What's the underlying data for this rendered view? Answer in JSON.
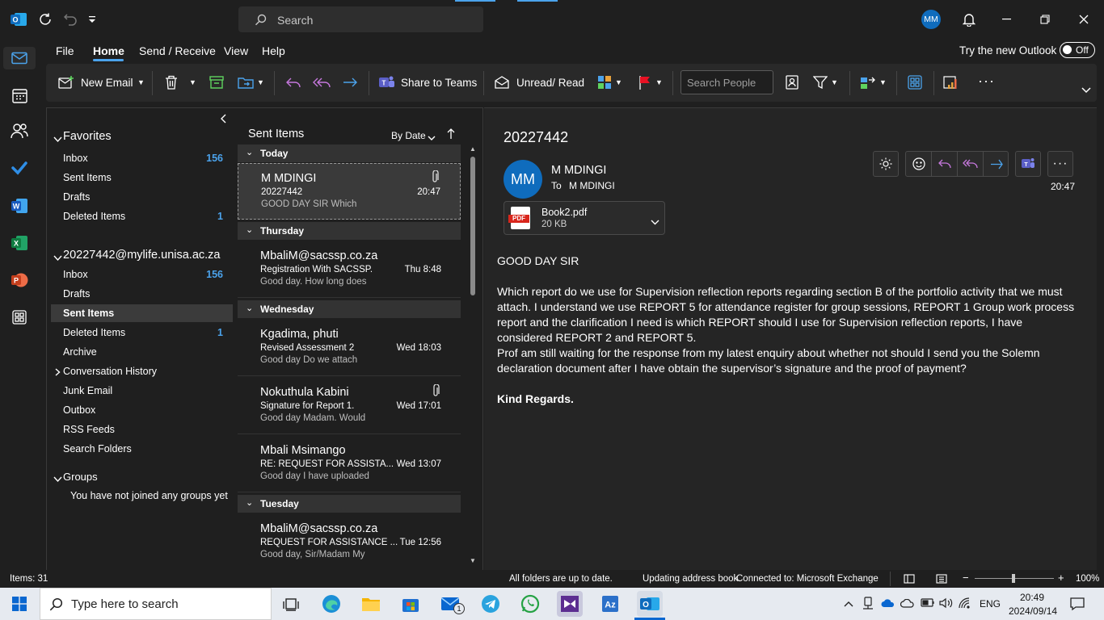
{
  "titlebar": {
    "search_placeholder": "Search",
    "user_initials": "MM",
    "try_new_outlook": "Try the new Outlook",
    "toggle_state": "Off"
  },
  "menu": {
    "tabs": [
      "File",
      "Home",
      "Send / Receive",
      "View",
      "Help"
    ],
    "active": "Home"
  },
  "ribbon": {
    "new_email": "New Email",
    "share_to_teams": "Share to Teams",
    "unread_read": "Unread/ Read",
    "search_people_placeholder": "Search People"
  },
  "folders": {
    "favorites_title": "Favorites",
    "favorites": [
      {
        "label": "Inbox",
        "count": "156"
      },
      {
        "label": "Sent Items",
        "count": ""
      },
      {
        "label": "Drafts",
        "count": ""
      },
      {
        "label": "Deleted Items",
        "count": "1"
      }
    ],
    "account_title": "20227442@mylife.unisa.ac.za",
    "account": [
      {
        "label": "Inbox",
        "count": "156"
      },
      {
        "label": "Drafts",
        "count": ""
      },
      {
        "label": "Sent Items",
        "count": ""
      },
      {
        "label": "Deleted Items",
        "count": "1"
      },
      {
        "label": "Archive",
        "count": ""
      },
      {
        "label": "Conversation History",
        "count": ""
      },
      {
        "label": "Junk Email",
        "count": ""
      },
      {
        "label": "Outbox",
        "count": ""
      },
      {
        "label": "RSS Feeds",
        "count": ""
      },
      {
        "label": "Search Folders",
        "count": ""
      }
    ],
    "groups_title": "Groups",
    "groups_note": "You have not joined any groups yet"
  },
  "list": {
    "title": "Sent Items",
    "sort": "By Date",
    "groups": [
      "Today",
      "Thursday",
      "Wednesday",
      "Tuesday"
    ],
    "messages": [
      {
        "from": "M MDINGI",
        "subject": "20227442",
        "preview": "GOOD DAY SIR  Which",
        "time": "20:47"
      },
      {
        "from": "MbaliM@sacssp.co.za",
        "subject": "Registration With SACSSP.",
        "preview": "Good day.  How long does",
        "time": "Thu 8:48"
      },
      {
        "from": "Kgadima, phuti",
        "subject": "Revised Assessment 2",
        "preview": "Good day  Do we attach",
        "time": "Wed 18:03"
      },
      {
        "from": "Nokuthula Kabini",
        "subject": "Signature for Report 1.",
        "preview": "Good day Madam.  Would",
        "time": "Wed 17:01"
      },
      {
        "from": "Mbali Msimango",
        "subject": "RE: REQUEST FOR ASSISTA...",
        "preview": "Good day   I have uploaded",
        "time": "Wed 13:07"
      },
      {
        "from": "MbaliM@sacssp.co.za",
        "subject": "REQUEST FOR ASSISTANCE ...",
        "preview": "Good day, Sir/Madam  My",
        "time": "Tue 12:56"
      }
    ]
  },
  "reading": {
    "subject": "20227442",
    "avatar": "MM",
    "sender": "M MDINGI",
    "to_label": "To",
    "to": "M MDINGI",
    "time": "20:47",
    "attachment": {
      "name": "Book2.pdf",
      "size": "20 KB",
      "badge": "PDF"
    },
    "body": {
      "greeting": "GOOD DAY SIR",
      "para1": "Which report do we use for Supervision reflection reports regarding section B of the portfolio activity that we must attach. I understand we use REPORT 5 for attendance register for group sessions, REPORT 1 Group work process report and the clarification I need is which REPORT should I use for Supervision reflection reports, I have considered REPORT 2 and REPORT 5.",
      "para2": "Prof am still waiting for the response from my latest enquiry about whether not should I send you the Solemn declaration document after I have obtain the supervisor’s signature and the proof of payment?",
      "closing": "Kind Regards."
    }
  },
  "status": {
    "items": "Items: 31",
    "sync": "All folders are up to date.",
    "updating": "Updating address book.",
    "connection": "Connected to: Microsoft Exchange",
    "zoom": "100%"
  },
  "taskbar": {
    "search_placeholder": "Type here to search",
    "lang": "ENG",
    "time": "20:49",
    "date": "2024/09/14",
    "mail_badge": "1"
  }
}
